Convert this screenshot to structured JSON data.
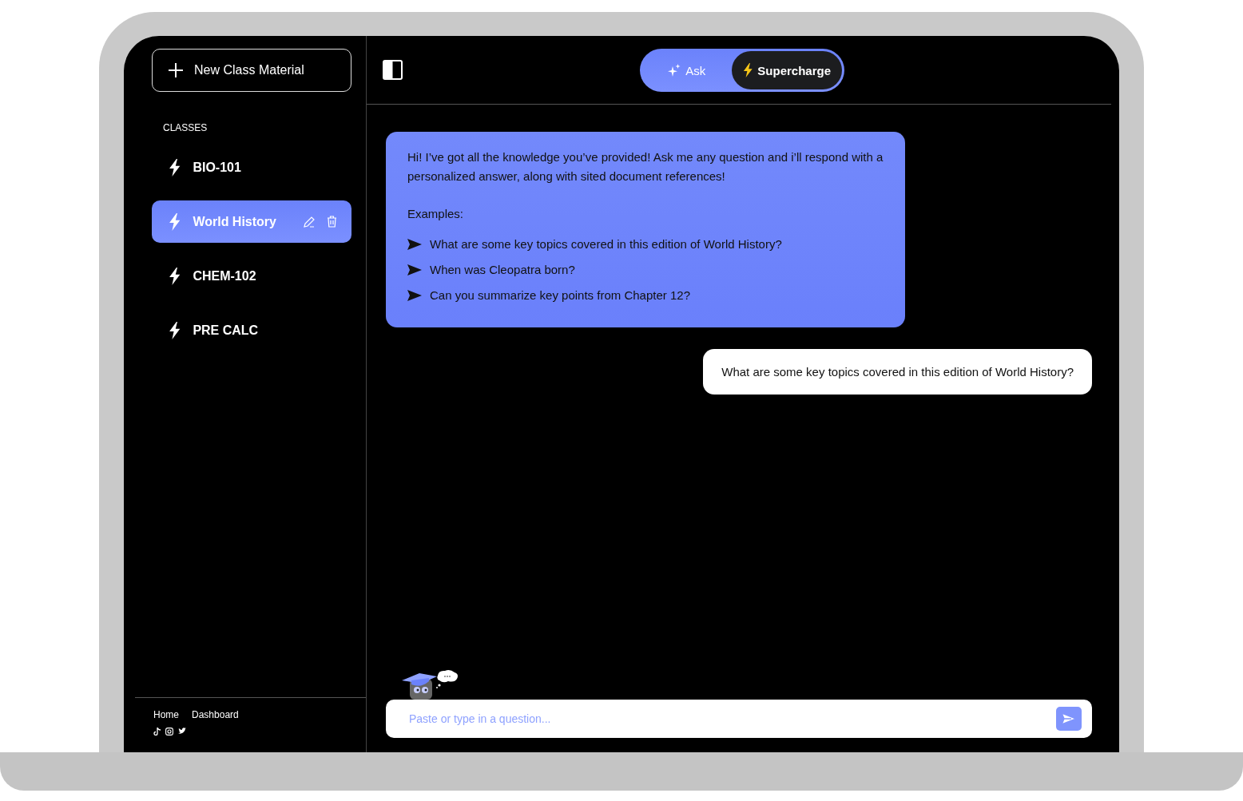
{
  "sidebar": {
    "new_button": {
      "label": "New Class Material"
    },
    "section_title": "CLASSES",
    "classes": [
      {
        "label": "BIO-101",
        "selected": false
      },
      {
        "label": "World History",
        "selected": true
      },
      {
        "label": "CHEM-102",
        "selected": false
      },
      {
        "label": "PRE CALC",
        "selected": false
      }
    ],
    "footer_links": [
      "Home",
      "Dashboard"
    ]
  },
  "mode_tabs": [
    {
      "label": "Ask",
      "selected": false
    },
    {
      "label": "Supercharge",
      "selected": true
    }
  ],
  "messages": [
    {
      "kind": "bot",
      "text": "Hi! I’ve got all the knowledge you’ve provided! Ask me any question and i’ll respond with a personalized answer, along with sited document references!",
      "examples_title": "Examples:",
      "examples": [
        "What are some key topics covered in this edition of World History?",
        "When was Cleopatra born?",
        "Can you summarize key points from Chapter 12?"
      ]
    },
    {
      "kind": "user",
      "text": "What are some key topics covered in this edition of World History?"
    }
  ],
  "input": {
    "placeholder": "Paste or type in a question..."
  }
}
